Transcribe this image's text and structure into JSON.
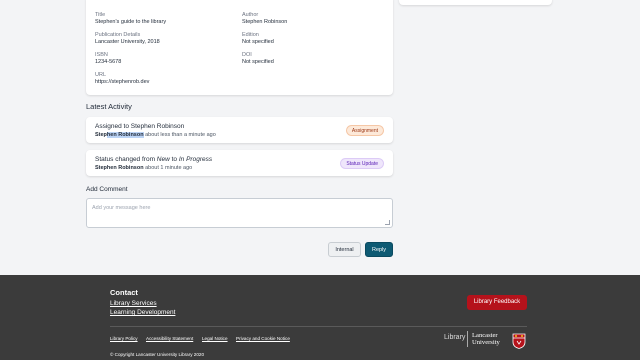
{
  "publication": {
    "title_label": "Title",
    "title_value": "Stephen's guide to the library",
    "author_label": "Author",
    "author_value": "Stephen Robinson",
    "pub_details_label": "Publication Details",
    "pub_details_value": "Lancaster University, 2018",
    "edition_label": "Edition",
    "edition_value": "Not specified",
    "isbn_label": "ISBN",
    "isbn_value": "1234-5678",
    "doi_label": "DOI",
    "doi_value": "Not specified",
    "url_label": "URL",
    "url_value": "https://stephenrob.dev"
  },
  "activity": {
    "heading": "Latest Activity",
    "items": [
      {
        "title": "Assigned to Stephen Robinson",
        "user_part1": "Step",
        "user_part2": "hen Robinson",
        "time": "about less than a minute ago",
        "badge": "Assignment"
      },
      {
        "title_prefix": "Status changed from ",
        "from_status": "New",
        "title_mid": " to ",
        "to_status": "In Progress",
        "user": "Stephen Robinson",
        "time": "about 1 minute ago",
        "badge": "Status Update"
      }
    ]
  },
  "comment": {
    "heading": "Add Comment",
    "placeholder": "Add your message here",
    "internal_label": "Internal",
    "reply_label": "Reply"
  },
  "footer": {
    "contact_heading": "Contact",
    "links": [
      "Library Services",
      "Learning Development"
    ],
    "feedback_label": "Library Feedback",
    "policy_links": [
      "Library Policy",
      "Accessibility Statement",
      "Legal Notice",
      "Privacy and Cookie Notice"
    ],
    "copyright": "© Copyright Lancaster University Library 2020",
    "logo_library": "Library",
    "logo_uni_line1": "Lancaster",
    "logo_uni_line2": "University"
  },
  "colors": {
    "reply_button": "#0e5a73",
    "feedback_button": "#b5121b",
    "footer_bg": "#3b3b3b",
    "assignment_badge_bg": "#fde9d9",
    "status_badge_bg": "#efe6fb"
  }
}
